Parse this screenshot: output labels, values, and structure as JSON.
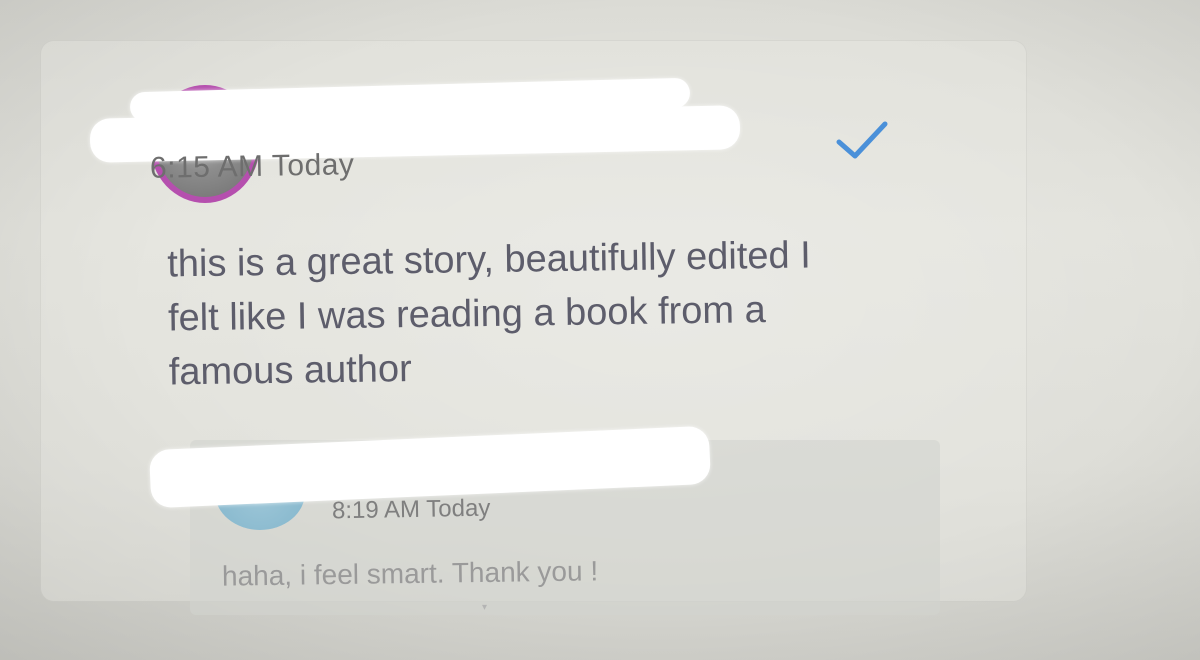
{
  "comments": [
    {
      "author": "",
      "time": "6:15 AM Today",
      "text_lines": [
        "this is a great story, beautifully edited I",
        "felt like I was reading a book from a",
        "famous author"
      ],
      "status_icon": "check-icon",
      "avatar_ring_color": "#b54fae"
    }
  ],
  "reply": {
    "author": "",
    "time": "8:19 AM Today",
    "text": "haha, i feel smart. Thank you !",
    "avatar_color": "#8fbfd4"
  },
  "colors": {
    "check": "#4a90d9",
    "background": "#e0e0da"
  }
}
